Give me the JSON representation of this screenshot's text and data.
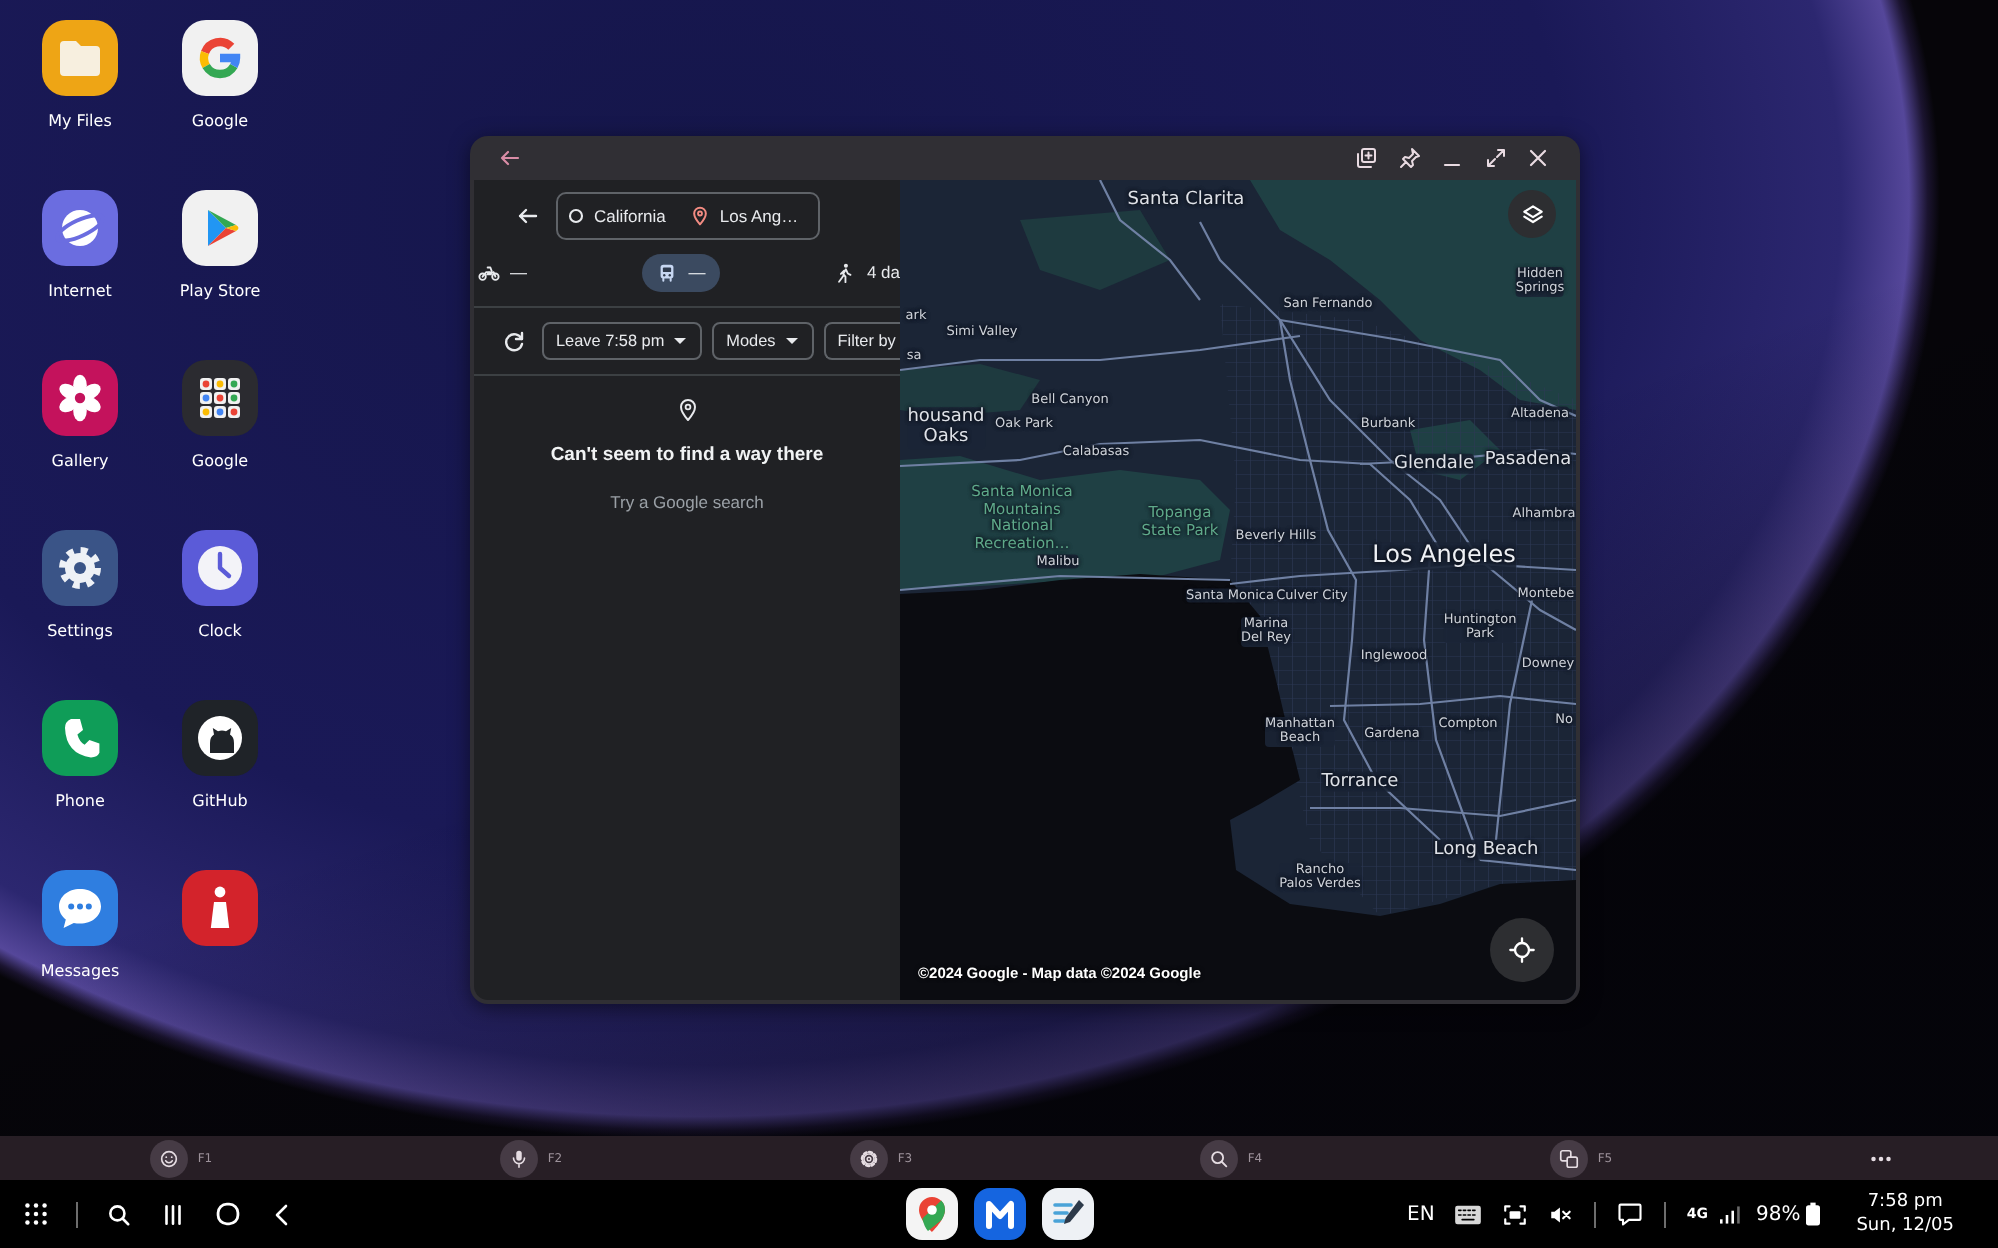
{
  "desktop": {
    "apps": [
      {
        "label": "My Files",
        "kind": "files"
      },
      {
        "label": "Google",
        "kind": "google"
      },
      {
        "label": "Internet",
        "kind": "internet"
      },
      {
        "label": "Play Store",
        "kind": "play"
      },
      {
        "label": "Gallery",
        "kind": "gallery"
      },
      {
        "label": "Google",
        "kind": "folder"
      },
      {
        "label": "Settings",
        "kind": "settings"
      },
      {
        "label": "Clock",
        "kind": "clock"
      },
      {
        "label": "Phone",
        "kind": "phone"
      },
      {
        "label": "GitHub",
        "kind": "github"
      },
      {
        "label": "Messages",
        "kind": "messages"
      },
      {
        "kind": "info"
      }
    ]
  },
  "window": {
    "directions": {
      "origin": "California",
      "destination": "Los Ang…",
      "modes": [
        {
          "kind": "motorcycle",
          "label": "—",
          "selected": false
        },
        {
          "kind": "transit",
          "label": "—",
          "selected": true
        },
        {
          "kind": "walk",
          "label": "4 da",
          "selected": false
        }
      ],
      "filters": [
        {
          "label": "Leave 7:58 pm",
          "dropdown": true
        },
        {
          "label": "Modes",
          "dropdown": true
        },
        {
          "label": "Filter by",
          "dropdown": false
        }
      ],
      "message": {
        "title": "Can't seem to find a way there",
        "hint": "Try a Google search"
      }
    },
    "map": {
      "labels": [
        {
          "lines": [
            "Santa Clarita"
          ],
          "kind": "town"
        },
        {
          "lines": [
            "Hidden",
            "Springs"
          ],
          "kind": "place"
        },
        {
          "lines": [
            "ark"
          ],
          "kind": "place"
        },
        {
          "lines": [
            "Simi Valley"
          ],
          "kind": "place"
        },
        {
          "lines": [
            "sa"
          ],
          "kind": "place"
        },
        {
          "lines": [
            "San Fernando"
          ],
          "kind": "place"
        },
        {
          "lines": [
            "Bell Canyon"
          ],
          "kind": "place"
        },
        {
          "lines": [
            "housand",
            "Oaks"
          ],
          "kind": "town"
        },
        {
          "lines": [
            "Oak Park"
          ],
          "kind": "place"
        },
        {
          "lines": [
            "Calabasas"
          ],
          "kind": "place"
        },
        {
          "lines": [
            "Burbank"
          ],
          "kind": "place"
        },
        {
          "lines": [
            "Altadena"
          ],
          "kind": "place"
        },
        {
          "lines": [
            "Glendale"
          ],
          "kind": "town"
        },
        {
          "lines": [
            "Pasadena"
          ],
          "kind": "town"
        },
        {
          "lines": [
            "Santa Monica",
            "Mountains",
            "National",
            "Recreation…"
          ],
          "kind": "park"
        },
        {
          "lines": [
            "Topanga",
            "State Park"
          ],
          "kind": "park"
        },
        {
          "lines": [
            "Beverly Hills"
          ],
          "kind": "place"
        },
        {
          "lines": [
            "Alhambra"
          ],
          "kind": "place"
        },
        {
          "lines": [
            "Malibu"
          ],
          "kind": "place"
        },
        {
          "lines": [
            "Los Angeles"
          ],
          "kind": "city"
        },
        {
          "lines": [
            "Santa Monica"
          ],
          "kind": "place"
        },
        {
          "lines": [
            "Culver City"
          ],
          "kind": "place"
        },
        {
          "lines": [
            "Montebe"
          ],
          "kind": "place"
        },
        {
          "lines": [
            "Marina",
            "Del Rey"
          ],
          "kind": "place"
        },
        {
          "lines": [
            "Huntington",
            "Park"
          ],
          "kind": "place"
        },
        {
          "lines": [
            "Inglewood"
          ],
          "kind": "place"
        },
        {
          "lines": [
            "Downey"
          ],
          "kind": "place"
        },
        {
          "lines": [
            "Manhattan",
            "Beach"
          ],
          "kind": "place"
        },
        {
          "lines": [
            "Gardena"
          ],
          "kind": "place"
        },
        {
          "lines": [
            "Compton"
          ],
          "kind": "place"
        },
        {
          "lines": [
            "No"
          ],
          "kind": "place"
        },
        {
          "lines": [
            "Torrance"
          ],
          "kind": "town"
        },
        {
          "lines": [
            "Long Beach"
          ],
          "kind": "town"
        },
        {
          "lines": [
            "Rancho",
            "Palos Verdes"
          ],
          "kind": "place"
        }
      ],
      "attribution": "©2024 Google - Map data ©2024 Google"
    }
  },
  "function_keys": [
    {
      "label": "F1",
      "kind": "emoji"
    },
    {
      "label": "F2",
      "kind": "mic"
    },
    {
      "label": "F3",
      "kind": "settings"
    },
    {
      "label": "F4",
      "kind": "search"
    },
    {
      "label": "F5",
      "kind": "translate"
    }
  ],
  "taskbar": {
    "pinned_apps": [
      {
        "kind": "maps"
      },
      {
        "kind": "m"
      },
      {
        "kind": "notes"
      }
    ],
    "language": "EN",
    "network": "4G",
    "battery": "98%",
    "time": "7:58 pm",
    "date": "Sun, 12/05"
  }
}
